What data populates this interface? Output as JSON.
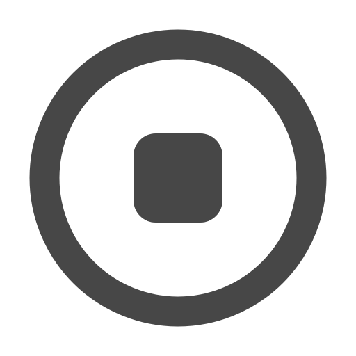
{
  "icon": {
    "name": "stop-circle-icon",
    "color": "#474747",
    "background": "#ffffff"
  }
}
